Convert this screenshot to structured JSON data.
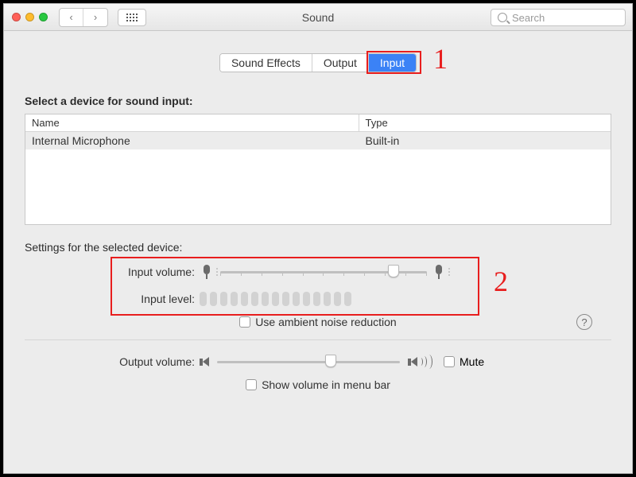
{
  "window": {
    "title": "Sound",
    "search_placeholder": "Search"
  },
  "tabs": {
    "effects": "Sound Effects",
    "output": "Output",
    "input": "Input",
    "active": "input"
  },
  "annotations": {
    "one": "1",
    "two": "2"
  },
  "devices": {
    "heading": "Select a device for sound input:",
    "col_name": "Name",
    "col_type": "Type",
    "rows": [
      {
        "name": "Internal Microphone",
        "type": "Built-in"
      }
    ]
  },
  "settings": {
    "heading": "Settings for the selected device:",
    "input_volume_label": "Input volume:",
    "input_volume_percent": 84,
    "input_level_label": "Input level:",
    "input_level_segments": 15,
    "ambient_label": "Use ambient noise reduction",
    "ambient_checked": false
  },
  "output": {
    "label": "Output volume:",
    "volume_percent": 62,
    "mute_label": "Mute",
    "mute_checked": false,
    "menubar_label": "Show volume in menu bar",
    "menubar_checked": false
  },
  "help": "?"
}
